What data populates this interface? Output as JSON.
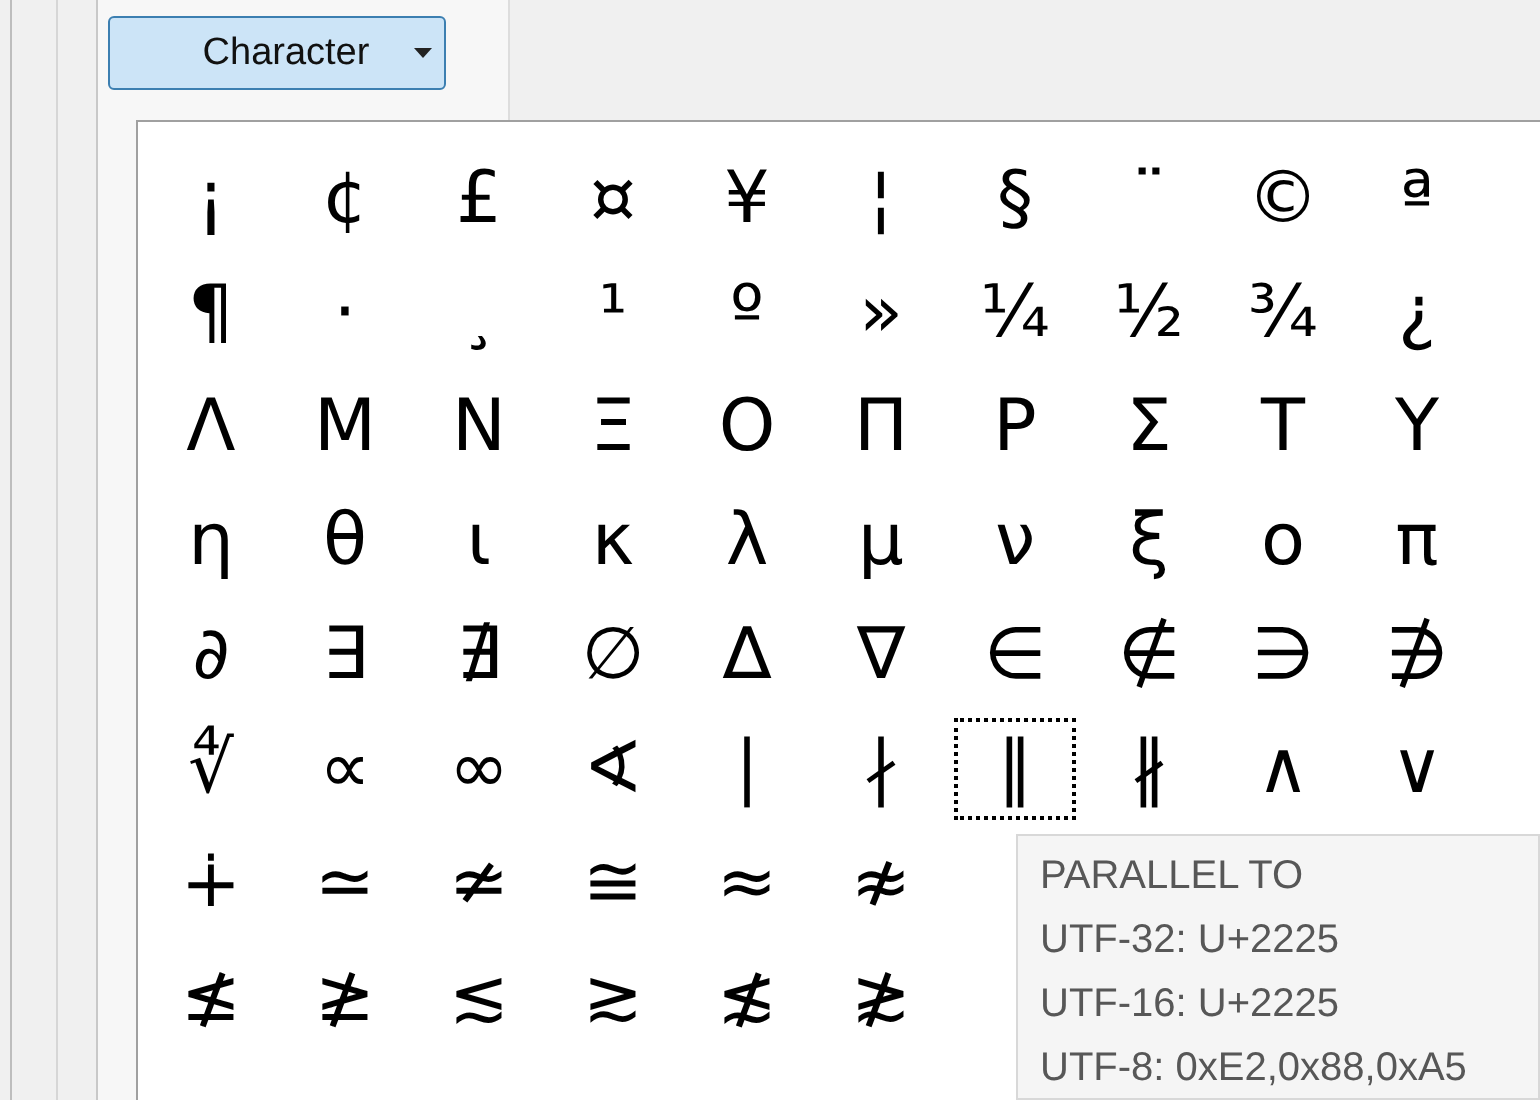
{
  "toolbar": {
    "dropdown": {
      "label": "Character"
    }
  },
  "grid": {
    "rows": [
      {
        "cells": [
          {
            "char": "¡",
            "selected": false
          },
          {
            "char": "¢",
            "selected": false
          },
          {
            "char": "£",
            "selected": false
          },
          {
            "char": "¤",
            "selected": false
          },
          {
            "char": "¥",
            "selected": false
          },
          {
            "char": "¦",
            "selected": false
          },
          {
            "char": "§",
            "selected": false
          },
          {
            "char": "¨",
            "selected": false
          },
          {
            "char": "©",
            "selected": false
          },
          {
            "char": "ª",
            "selected": false
          }
        ]
      },
      {
        "cells": [
          {
            "char": "¶",
            "selected": false
          },
          {
            "char": "·",
            "selected": false
          },
          {
            "char": "¸",
            "selected": false
          },
          {
            "char": "¹",
            "selected": false
          },
          {
            "char": "º",
            "selected": false
          },
          {
            "char": "»",
            "selected": false
          },
          {
            "char": "¼",
            "selected": false
          },
          {
            "char": "½",
            "selected": false
          },
          {
            "char": "¾",
            "selected": false
          },
          {
            "char": "¿",
            "selected": false
          }
        ]
      },
      {
        "cells": [
          {
            "char": "Λ",
            "selected": false
          },
          {
            "char": "Μ",
            "selected": false
          },
          {
            "char": "Ν",
            "selected": false
          },
          {
            "char": "Ξ",
            "selected": false
          },
          {
            "char": "Ο",
            "selected": false
          },
          {
            "char": "Π",
            "selected": false
          },
          {
            "char": "Ρ",
            "selected": false
          },
          {
            "char": "Σ",
            "selected": false
          },
          {
            "char": "Τ",
            "selected": false
          },
          {
            "char": "Υ",
            "selected": false
          }
        ]
      },
      {
        "cells": [
          {
            "char": "η",
            "selected": false
          },
          {
            "char": "θ",
            "selected": false
          },
          {
            "char": "ι",
            "selected": false
          },
          {
            "char": "κ",
            "selected": false
          },
          {
            "char": "λ",
            "selected": false
          },
          {
            "char": "μ",
            "selected": false
          },
          {
            "char": "ν",
            "selected": false
          },
          {
            "char": "ξ",
            "selected": false
          },
          {
            "char": "ο",
            "selected": false
          },
          {
            "char": "π",
            "selected": false
          }
        ]
      },
      {
        "cells": [
          {
            "char": "∂",
            "selected": false
          },
          {
            "char": "∃",
            "selected": false
          },
          {
            "char": "∄",
            "selected": false
          },
          {
            "char": "∅",
            "selected": false
          },
          {
            "char": "∆",
            "selected": false
          },
          {
            "char": "∇",
            "selected": false
          },
          {
            "char": "∈",
            "selected": false
          },
          {
            "char": "∉",
            "selected": false
          },
          {
            "char": "∋",
            "selected": false
          },
          {
            "char": "∌",
            "selected": false
          }
        ]
      },
      {
        "cells": [
          {
            "char": "∜",
            "selected": false
          },
          {
            "char": "∝",
            "selected": false
          },
          {
            "char": "∞",
            "selected": false
          },
          {
            "char": "∢",
            "selected": false
          },
          {
            "char": "∣",
            "selected": false
          },
          {
            "char": "∤",
            "selected": false
          },
          {
            "char": "∥",
            "selected": true
          },
          {
            "char": "∦",
            "selected": false
          },
          {
            "char": "∧",
            "selected": false
          },
          {
            "char": "∨",
            "selected": false
          }
        ]
      },
      {
        "cells": [
          {
            "char": "∔",
            "selected": false
          },
          {
            "char": "≃",
            "selected": false
          },
          {
            "char": "≄",
            "selected": false
          },
          {
            "char": "≅",
            "selected": false
          },
          {
            "char": "≈",
            "selected": false
          },
          {
            "char": "≉",
            "selected": false
          }
        ]
      },
      {
        "cells": [
          {
            "char": "≰",
            "selected": false
          },
          {
            "char": "≱",
            "selected": false
          },
          {
            "char": "≲",
            "selected": false
          },
          {
            "char": "≳",
            "selected": false
          },
          {
            "char": "≴",
            "selected": false
          },
          {
            "char": "≵",
            "selected": false
          }
        ]
      }
    ]
  },
  "tooltip": {
    "lines": [
      "PARALLEL TO",
      "UTF-32: U+2225",
      "UTF-16: U+2225",
      "UTF-8: 0xE2,0x88,0xA5"
    ]
  }
}
